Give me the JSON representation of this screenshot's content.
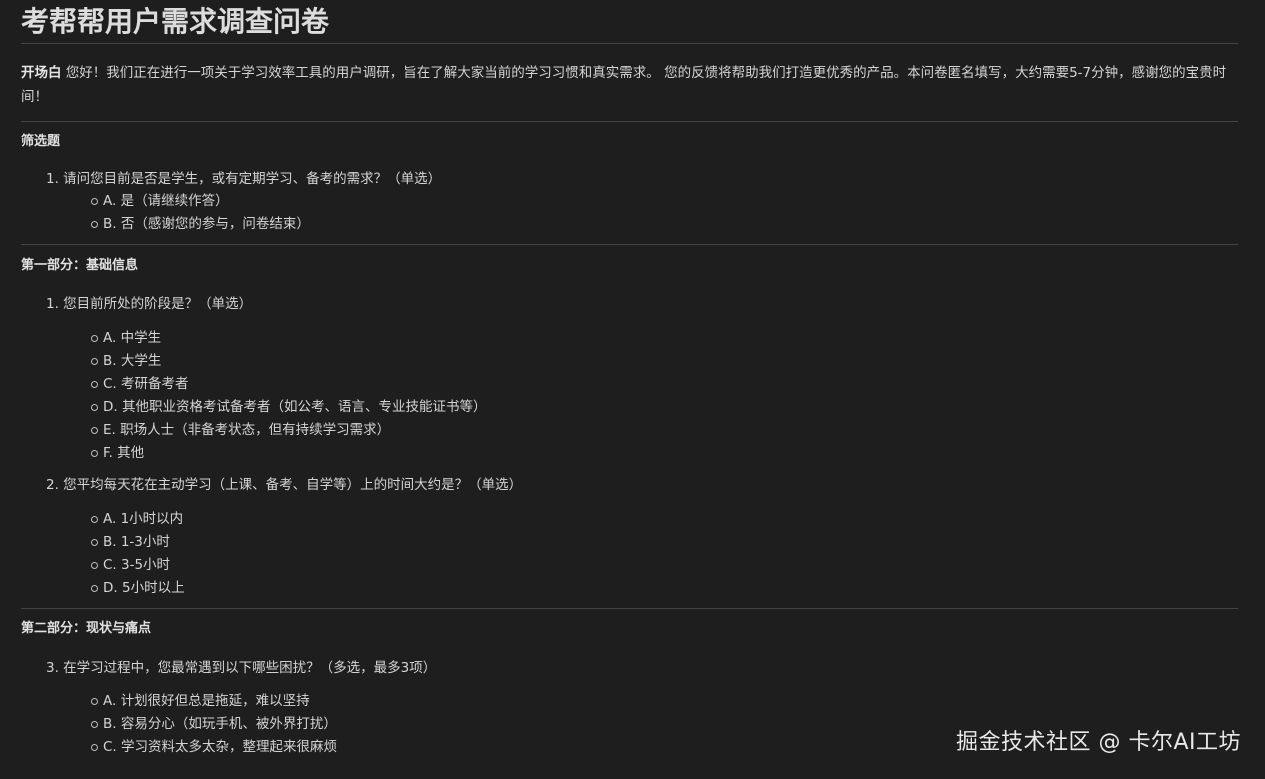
{
  "title": "考帮帮用户需求调查问卷",
  "intro": {
    "label": "开场白",
    "text": " 您好！我们正在进行一项关于学习效率工具的用户调研，旨在了解大家当前的学习习惯和真实需求。 您的反馈将帮助我们打造更优秀的产品。本问卷匿名填写，大约需要5-7分钟，感谢您的宝贵时间！"
  },
  "sections": [
    {
      "title": "筛选题",
      "questions": [
        {
          "text": "1. 请问您目前是否是学生，或有定期学习、备考的需求？（单选）",
          "options": [
            "A. 是（请继续作答）",
            "B. 否（感谢您的参与，问卷结束）"
          ]
        }
      ]
    },
    {
      "title": "第一部分：基础信息",
      "questions": [
        {
          "text": "1. 您目前所处的阶段是？（单选）",
          "options": [
            "A. 中学生",
            "B. 大学生",
            "C. 考研备考者",
            "D. 其他职业资格考试备考者（如公考、语言、专业技能证书等）",
            "E. 职场人士（非备考状态，但有持续学习需求）",
            "F. 其他"
          ]
        },
        {
          "text": "2. 您平均每天花在主动学习（上课、备考、自学等）上的时间大约是？（单选）",
          "options": [
            "A. 1小时以内",
            "B. 1-3小时",
            "C. 3-5小时",
            "D. 5小时以上"
          ]
        }
      ]
    },
    {
      "title": "第二部分：现状与痛点",
      "questions": [
        {
          "text": "3. 在学习过程中，您最常遇到以下哪些困扰？（多选，最多3项）",
          "options": [
            "A. 计划很好但总是拖延，难以坚持",
            "B. 容易分心（如玩手机、被外界打扰）",
            "C. 学习资料太多太杂，整理起来很麻烦"
          ]
        }
      ]
    }
  ],
  "watermark": "掘金技术社区 @ 卡尔AI工坊"
}
